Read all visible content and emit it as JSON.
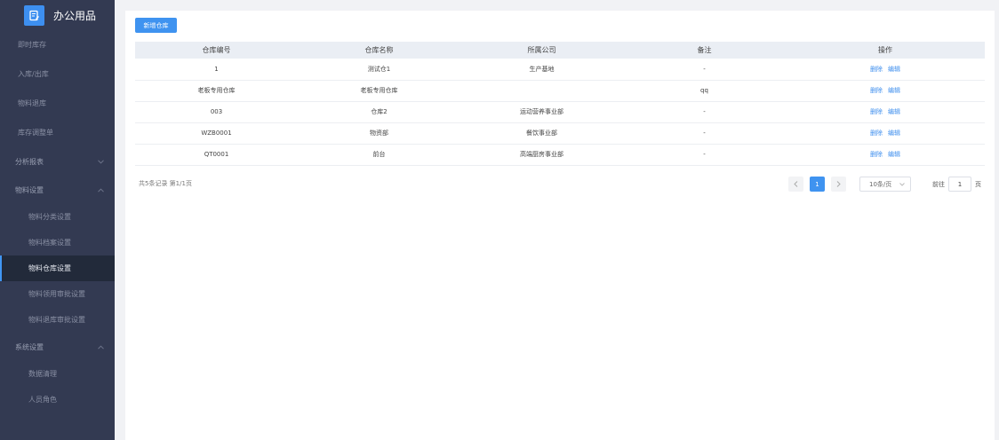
{
  "app": {
    "title": "办公用品",
    "logo_icon": "note-edit-icon"
  },
  "sidebar": {
    "items": [
      {
        "label": "即时库存"
      },
      {
        "label": "入库/出库"
      },
      {
        "label": "物料退库"
      },
      {
        "label": "库存调整单"
      }
    ],
    "groups": [
      {
        "label": "分析报表",
        "expanded": false
      },
      {
        "label": "物料设置",
        "expanded": true
      },
      {
        "label": "系统设置",
        "expanded": true
      }
    ],
    "material_sub": [
      {
        "label": "物料分类设置"
      },
      {
        "label": "物料档案设置"
      },
      {
        "label": "物料仓库设置",
        "active": true
      },
      {
        "label": "物料领用审批设置"
      },
      {
        "label": "物料退库审批设置"
      }
    ],
    "system_sub": [
      {
        "label": "数据清理"
      },
      {
        "label": "人员角色"
      }
    ]
  },
  "toolbar": {
    "add_label": "新增仓库"
  },
  "table": {
    "headers": [
      "仓库编号",
      "仓库名称",
      "所属公司",
      "备注",
      "操作"
    ],
    "rows": [
      [
        "1",
        "测试仓1",
        "生产基地",
        "-"
      ],
      [
        "老板专用仓库",
        "老板专用仓库",
        "",
        "qq"
      ],
      [
        "003",
        "仓库2",
        "运动营养事业部",
        "-"
      ],
      [
        "WZB0001",
        "物资部",
        "餐饮事业部",
        "-"
      ],
      [
        "QT0001",
        "前台",
        "高端厨房事业部",
        "-"
      ]
    ],
    "delete_label": "删除",
    "edit_label": "编辑"
  },
  "pagination": {
    "summary": "共5条记录 第1/1页",
    "current_page": "1",
    "page_size": "10条/页",
    "goto_prefix": "前往",
    "goto_value": "1",
    "goto_suffix": "页"
  },
  "colors": {
    "primary": "#3f93f0",
    "sidebar_bg": "#333a52",
    "active_bg": "#222a3a"
  }
}
